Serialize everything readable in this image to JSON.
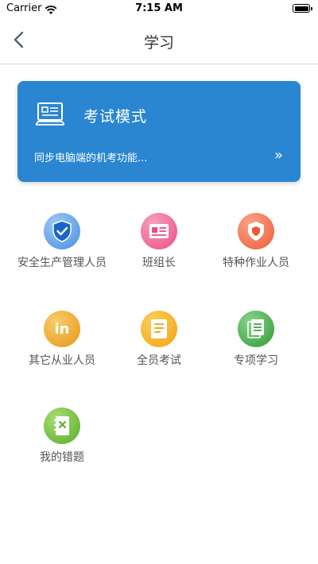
{
  "status": {
    "carrier": "Carrier",
    "time": "7:15 AM"
  },
  "nav": {
    "title": "学习"
  },
  "exam_card": {
    "title": "考试模式",
    "subtitle": "同步电脑端的机考功能...",
    "arrow": "»"
  },
  "grid": [
    {
      "label": "安全生产管理人员",
      "icon": "shield-check-icon",
      "color": "#4a8fe3"
    },
    {
      "label": "班组长",
      "icon": "id-card-icon",
      "color": "#ee5d8e"
    },
    {
      "label": "特种作业人员",
      "icon": "shield-icon",
      "color": "#f26a4b"
    },
    {
      "label": "其它从业人员",
      "icon": "linkedin-icon",
      "color": "#f0a020"
    },
    {
      "label": "全员考试",
      "icon": "checklist-icon",
      "color": "#f5a818"
    },
    {
      "label": "专项学习",
      "icon": "documents-icon",
      "color": "#3cad3c"
    },
    {
      "label": "我的错题",
      "icon": "notebook-icon",
      "color": "#68bb38"
    }
  ]
}
